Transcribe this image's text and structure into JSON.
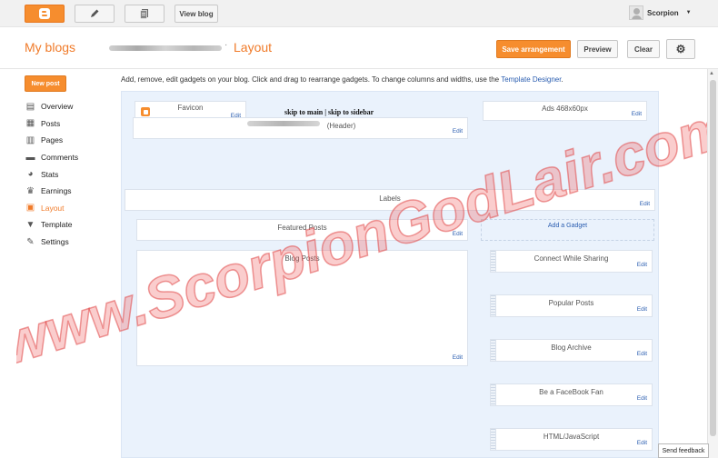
{
  "topbar": {
    "view_blog": "View blog",
    "user_name": "Scorpion",
    "user_caret": "▼"
  },
  "header": {
    "my_blogs": "My blogs",
    "separator": "·",
    "page_title": "Layout",
    "save_arrangement": "Save arrangement",
    "preview": "Preview",
    "clear": "Clear",
    "settings_icon": "⚙"
  },
  "sidebar": {
    "new_post": "New post",
    "items": [
      {
        "label": "Overview",
        "icon": "▤",
        "icon_name": "overview-icon"
      },
      {
        "label": "Posts",
        "icon": "▦",
        "icon_name": "posts-icon"
      },
      {
        "label": "Pages",
        "icon": "▥",
        "icon_name": "pages-icon"
      },
      {
        "label": "Comments",
        "icon": "▬",
        "icon_name": "comments-icon"
      },
      {
        "label": "Stats",
        "icon": "◕",
        "icon_name": "stats-icon"
      },
      {
        "label": "Earnings",
        "icon": "♛",
        "icon_name": "earnings-icon"
      },
      {
        "label": "Layout",
        "icon": "▣",
        "icon_name": "layout-icon",
        "active": true
      },
      {
        "label": "Template",
        "icon": "▼",
        "icon_name": "template-icon"
      },
      {
        "label": "Settings",
        "icon": "✎",
        "icon_name": "settings-icon"
      }
    ]
  },
  "intro": {
    "text": "Add, remove, edit gadgets on your blog. Click and drag to rearrange gadgets. To change columns and widths, use the ",
    "link": "Template Designer",
    "suffix": "."
  },
  "layout": {
    "skip_links": "skip to main | skip to sidebar",
    "edit": "Edit",
    "favicon": "Favicon",
    "header": "(Header)",
    "ads": "Ads 468x60px",
    "labels": "Labels",
    "featured_posts": "Featured Posts",
    "add_gadget": "Add a Gadget",
    "blog_posts": "Blog Posts",
    "sidebar_gadgets": [
      "Connect While Sharing",
      "Popular Posts",
      "Blog Archive",
      "Be a FaceBook Fan",
      "HTML/JavaScript"
    ]
  },
  "watermark": "www.ScorpionGodLair.com",
  "feedback": "Send feedback",
  "colors": {
    "accent": "#f68d2e",
    "link": "#2a5db0",
    "canvas": "#eaf2fc",
    "watermark": "#f05a5a"
  }
}
